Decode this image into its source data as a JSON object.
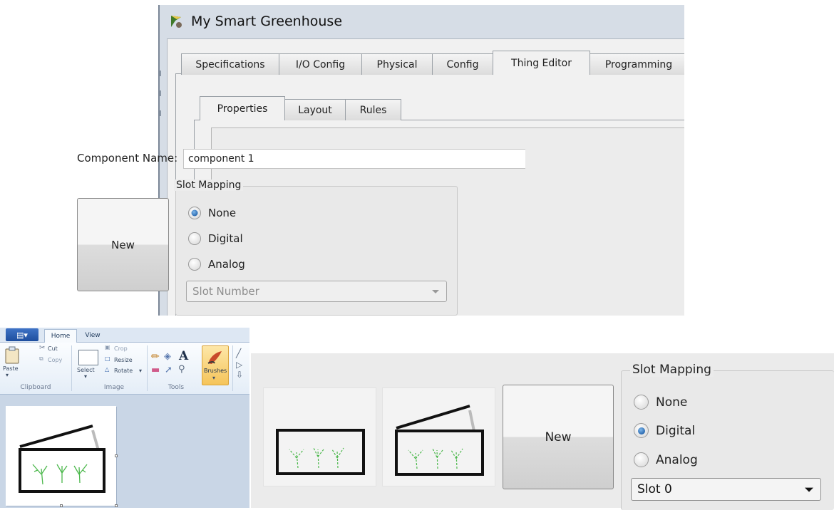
{
  "window": {
    "title": "My Smart Greenhouse",
    "main_tabs": [
      "Specifications",
      "I/O Config",
      "Physical",
      "Config",
      "Thing Editor",
      "Programming"
    ],
    "active_main_tab": "Thing Editor",
    "sub_tabs": [
      "Properties",
      "Layout",
      "Rules"
    ],
    "active_sub_tab": "Properties",
    "component_name_label": "Component Name:",
    "component_name_value": "component 1",
    "new_button": "New",
    "slot_mapping": {
      "title": "Slot Mapping",
      "options": [
        "None",
        "Digital",
        "Analog"
      ],
      "selected": "None",
      "slot_number_placeholder": "Slot Number"
    }
  },
  "paint": {
    "tabs": [
      "Home",
      "View"
    ],
    "active_tab": "Home",
    "clipboard": {
      "paste": "Paste",
      "cut": "Cut",
      "copy": "Copy",
      "group_label": "Clipboard"
    },
    "image": {
      "select": "Select",
      "crop": "Crop",
      "resize": "Resize",
      "rotate": "Rotate",
      "group_label": "Image"
    },
    "tools": {
      "group_label": "Tools",
      "text_tool": "A"
    },
    "brushes": "Brushes"
  },
  "detail": {
    "new_button": "New",
    "slot_mapping": {
      "title": "Slot Mapping",
      "options": [
        "None",
        "Digital",
        "Analog"
      ],
      "selected": "Digital",
      "slot_value": "Slot 0"
    }
  },
  "colors": {
    "radio_selected": "#1f5fa8",
    "plant_green": "#4cb84c",
    "paint_blue": "#1d4e9e"
  }
}
